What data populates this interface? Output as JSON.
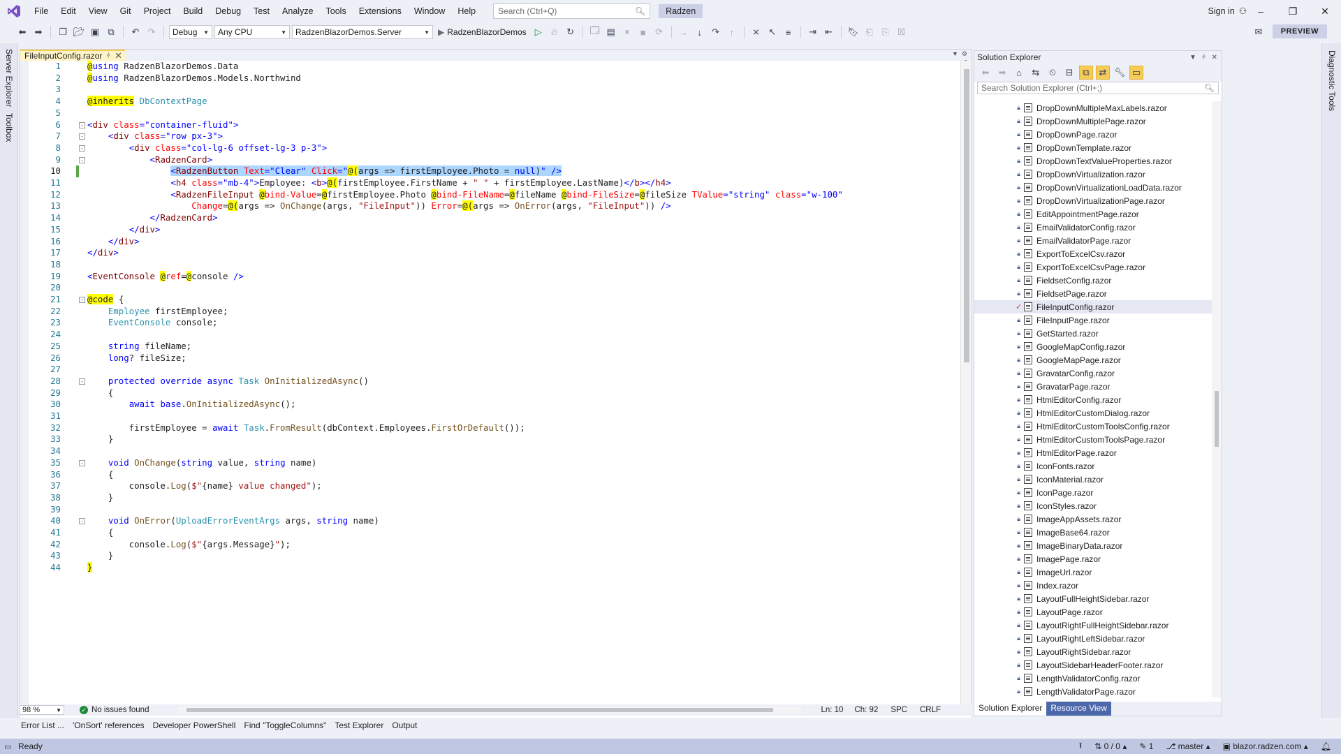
{
  "menubar": {
    "items": [
      "File",
      "Edit",
      "View",
      "Git",
      "Project",
      "Build",
      "Debug",
      "Test",
      "Analyze",
      "Tools",
      "Extensions",
      "Window",
      "Help"
    ],
    "search_placeholder": "Search (Ctrl+Q)",
    "solution_name": "Radzen",
    "sign_in": "Sign in"
  },
  "toolbar": {
    "config": "Debug",
    "platform": "Any CPU",
    "startup_project": "RadzenBlazorDemos.Server",
    "run_target": "RadzenBlazorDemos",
    "preview": "PREVIEW"
  },
  "side_tabs": {
    "left": [
      "Server Explorer",
      "Toolbox"
    ],
    "right": [
      "Diagnostic Tools"
    ]
  },
  "editor": {
    "tab_title": "FileInputConfig.razor",
    "zoom": "98 %",
    "issues": "No issues found",
    "ln": "Ln: 10",
    "ch": "Ch: 92",
    "spc": "SPC",
    "eol": "CRLF",
    "line_numbers": [
      "1",
      "2",
      "3",
      "4",
      "5",
      "6",
      "7",
      "8",
      "9",
      "10",
      "11",
      "12",
      "13",
      "14",
      "15",
      "16",
      "17",
      "18",
      "19",
      "20",
      "21",
      "22",
      "23",
      "24",
      "25",
      "26",
      "27",
      "28",
      "29",
      "30",
      "31",
      "32",
      "33",
      "34",
      "35",
      "36",
      "37",
      "38",
      "39",
      "40",
      "41",
      "42",
      "43",
      "44"
    ]
  },
  "solution_explorer": {
    "title": "Solution Explorer",
    "search_placeholder": "Search Solution Explorer (Ctrl+;)",
    "files": [
      "DropDownMultipleMaxLabels.razor",
      "DropDownMultiplePage.razor",
      "DropDownPage.razor",
      "DropDownTemplate.razor",
      "DropDownTextValueProperties.razor",
      "DropDownVirtualization.razor",
      "DropDownVirtualizationLoadData.razor",
      "DropDownVirtualizationPage.razor",
      "EditAppointmentPage.razor",
      "EmailValidatorConfig.razor",
      "EmailValidatorPage.razor",
      "ExportToExcelCsv.razor",
      "ExportToExcelCsvPage.razor",
      "FieldsetConfig.razor",
      "FieldsetPage.razor",
      "FileInputConfig.razor",
      "FileInputPage.razor",
      "GetStarted.razor",
      "GoogleMapConfig.razor",
      "GoogleMapPage.razor",
      "GravatarConfig.razor",
      "GravatarPage.razor",
      "HtmlEditorConfig.razor",
      "HtmlEditorCustomDialog.razor",
      "HtmlEditorCustomToolsConfig.razor",
      "HtmlEditorCustomToolsPage.razor",
      "HtmlEditorPage.razor",
      "IconFonts.razor",
      "IconMaterial.razor",
      "IconPage.razor",
      "IconStyles.razor",
      "ImageAppAssets.razor",
      "ImageBase64.razor",
      "ImageBinaryData.razor",
      "ImagePage.razor",
      "ImageUrl.razor",
      "Index.razor",
      "LayoutFullHeightSidebar.razor",
      "LayoutPage.razor",
      "LayoutRightFullHeightSidebar.razor",
      "LayoutRightLeftSidebar.razor",
      "LayoutRightSidebar.razor",
      "LayoutSidebarHeaderFooter.razor",
      "LengthValidatorConfig.razor",
      "LengthValidatorPage.razor"
    ],
    "selected_file": "FileInputConfig.razor",
    "tabs": [
      "Solution Explorer",
      "Resource View"
    ]
  },
  "tool_tabs": [
    "Error List ...",
    "'OnSort' references",
    "Developer PowerShell",
    "Find \"ToggleColumns\"",
    "Test Explorer",
    "Output"
  ],
  "statusbar": {
    "ready": "Ready",
    "errors": "0 / 0",
    "pencil": "1",
    "branch": "master",
    "repo": "blazor.radzen.com"
  }
}
